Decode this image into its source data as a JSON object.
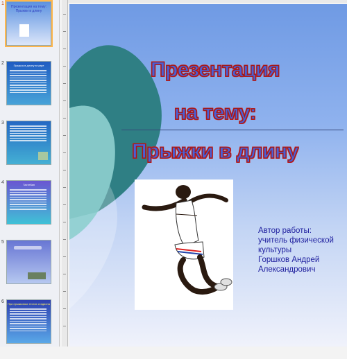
{
  "thumbnails": [
    {
      "number": "1",
      "title": "Презентация на тему: Прыжки в длину",
      "bg": "#3a7fcf"
    },
    {
      "number": "2",
      "title": "Прыжок в длину в мире",
      "bg": "#1f5cc2"
    },
    {
      "number": "3",
      "title": "",
      "bg": "#2468c4"
    },
    {
      "number": "4",
      "title": "Тахтебан",
      "bg": "#6a56d2"
    },
    {
      "number": "5",
      "title": "",
      "bg": "#6876d4"
    },
    {
      "number": "6",
      "title": "При прыжковых тестах стадиона",
      "bg": "#2d3fb0"
    }
  ],
  "slide": {
    "title_line1": "Презентация",
    "title_line2": "на тему:",
    "title_line3": "Прыжки в длину",
    "author_label": "Автор работы:",
    "author_line1": "учитель физической",
    "author_line2": "культуры",
    "author_name1": "Горшков Андрей",
    "author_name2": "Александрович"
  },
  "colors": {
    "title_fill": "#4a5fd6",
    "title_outline": "#a01a1a",
    "author_text": "#1e1e9e",
    "teal_shape": "#2f7f84"
  }
}
